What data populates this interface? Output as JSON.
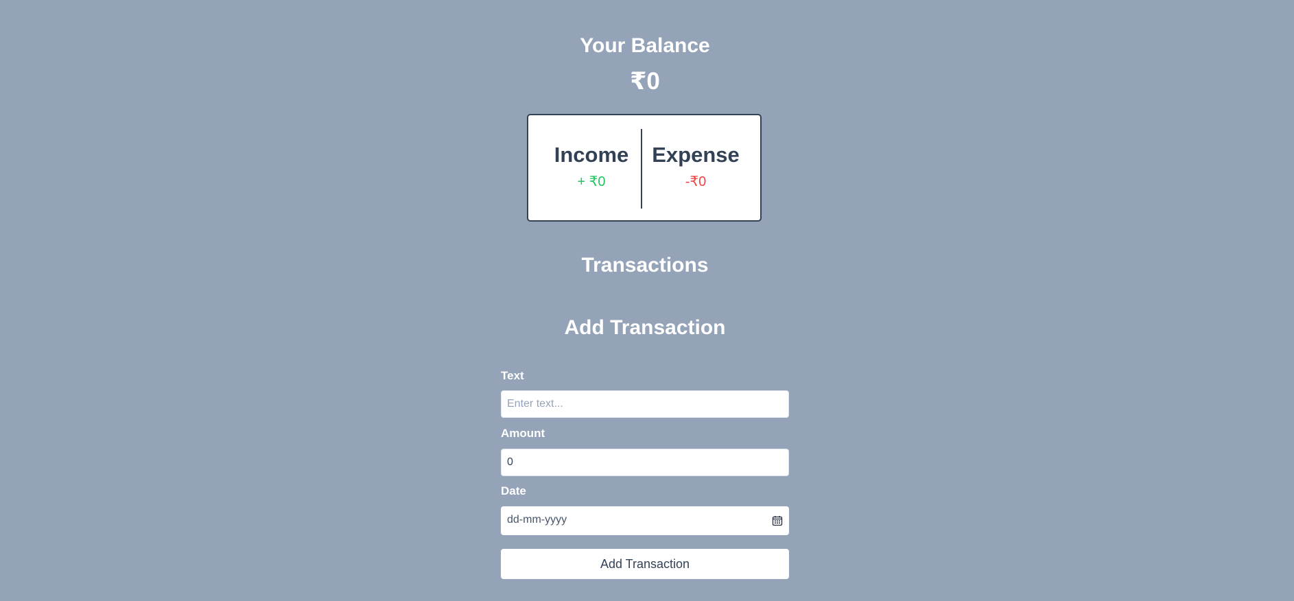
{
  "balance": {
    "title": "Your Balance",
    "amount": "₹0"
  },
  "summary": {
    "income_label": "Income",
    "income_value": "+ ₹0",
    "expense_label": "Expense",
    "expense_value": "-₹0"
  },
  "transactions": {
    "title": "Transactions"
  },
  "add_transaction": {
    "title": "Add Transaction",
    "text_label": "Text",
    "text_placeholder": "Enter text...",
    "amount_label": "Amount",
    "amount_value": "0",
    "date_label": "Date",
    "date_placeholder": "dd-mm-yyyy",
    "submit_label": "Add Transaction"
  },
  "colors": {
    "background": "#94a3b8",
    "income": "#22c55e",
    "expense": "#ef4444",
    "text_dark": "#334155"
  },
  "icons": {
    "date": "calendar-icon"
  }
}
